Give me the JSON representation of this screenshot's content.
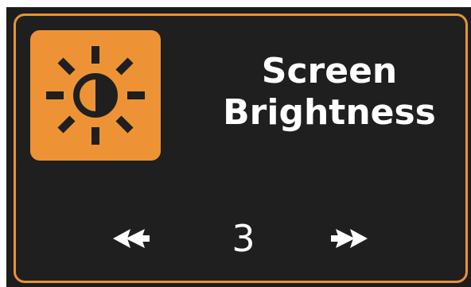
{
  "setting": {
    "title_line1": "Screen",
    "title_line2": "Brightness",
    "value": "3"
  },
  "icons": {
    "setting_icon": "brightness-sun-icon",
    "decrease": "double-chevron-left-icon",
    "increase": "double-chevron-right-icon"
  },
  "colors": {
    "accent": "#ED9335",
    "border": "#E49438",
    "panel_bg": "#1F1F1F",
    "text": "#FFFFFF"
  }
}
